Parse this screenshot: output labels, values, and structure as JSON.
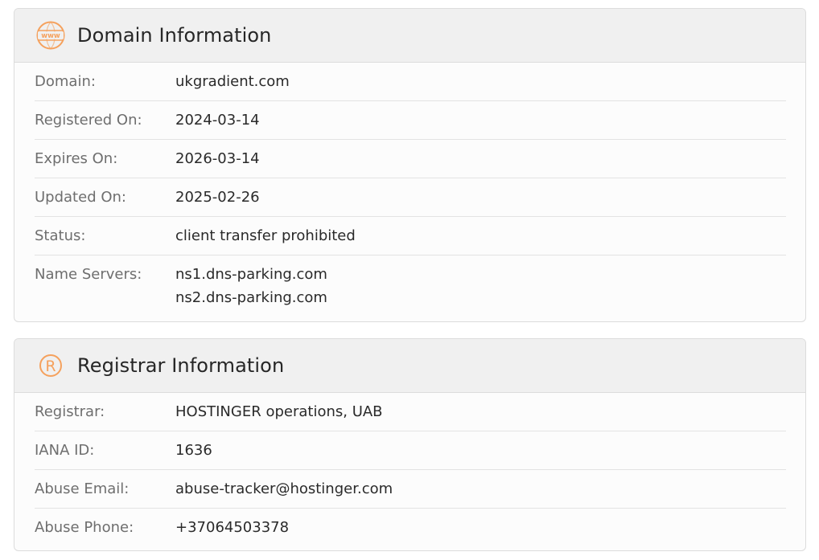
{
  "colors": {
    "accent": "#f5a15d",
    "header_bg": "#f0f0f0",
    "card_bg": "#fcfcfc",
    "border": "#dcdcdc",
    "label": "#6e6e6e",
    "value": "#2a2a2a"
  },
  "domain_info": {
    "title": "Domain Information",
    "icon": "www-globe-icon",
    "rows": [
      {
        "label": "Domain:",
        "value": "ukgradient.com"
      },
      {
        "label": "Registered On:",
        "value": "2024-03-14"
      },
      {
        "label": "Expires On:",
        "value": "2026-03-14"
      },
      {
        "label": "Updated On:",
        "value": "2025-02-26"
      },
      {
        "label": "Status:",
        "value": "client transfer prohibited"
      },
      {
        "label": "Name Servers:",
        "values": [
          "ns1.dns-parking.com",
          "ns2.dns-parking.com"
        ]
      }
    ]
  },
  "registrar_info": {
    "title": "Registrar Information",
    "icon": "registered-icon",
    "rows": [
      {
        "label": "Registrar:",
        "value": "HOSTINGER operations, UAB"
      },
      {
        "label": "IANA ID:",
        "value": "1636"
      },
      {
        "label": "Abuse Email:",
        "value": "abuse-tracker@hostinger.com"
      },
      {
        "label": "Abuse Phone:",
        "value": "+37064503378"
      }
    ]
  }
}
